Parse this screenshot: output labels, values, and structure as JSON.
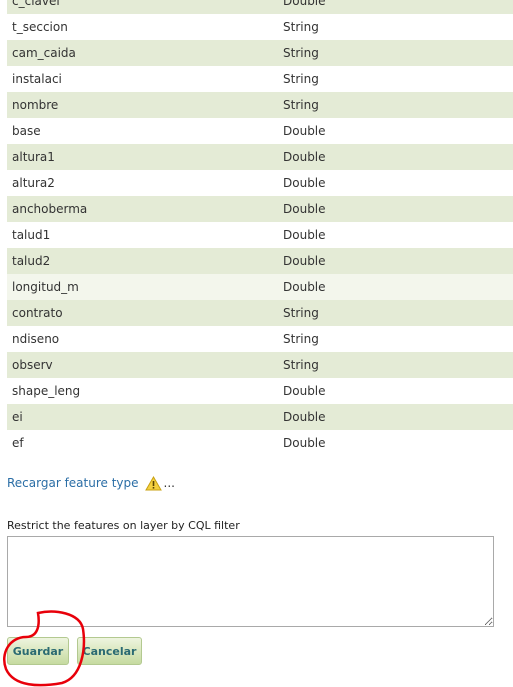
{
  "attributes": [
    {
      "name": "c_clavel",
      "type": "Double"
    },
    {
      "name": "t_seccion",
      "type": "String"
    },
    {
      "name": "cam_caida",
      "type": "String"
    },
    {
      "name": "instalaci",
      "type": "String"
    },
    {
      "name": "nombre",
      "type": "String"
    },
    {
      "name": "base",
      "type": "Double"
    },
    {
      "name": "altura1",
      "type": "Double"
    },
    {
      "name": "altura2",
      "type": "Double"
    },
    {
      "name": "anchoberma",
      "type": "Double"
    },
    {
      "name": "talud1",
      "type": "Double"
    },
    {
      "name": "talud2",
      "type": "Double"
    },
    {
      "name": "longitud_m",
      "type": "Double"
    },
    {
      "name": "contrato",
      "type": "String"
    },
    {
      "name": "ndiseno",
      "type": "String"
    },
    {
      "name": "observ",
      "type": "String"
    },
    {
      "name": "shape_leng",
      "type": "Double"
    },
    {
      "name": "ei",
      "type": "Double"
    },
    {
      "name": "ef",
      "type": "Double"
    }
  ],
  "reload": {
    "label": "Recargar feature type",
    "dots": "...",
    "icon": "warning-icon"
  },
  "cql": {
    "label": "Restrict the features on layer by CQL filter",
    "value": ""
  },
  "buttons": {
    "save": "Guardar",
    "cancel": "Cancelar"
  },
  "colors": {
    "row_alt": "#e4ebd6",
    "link": "#2b6ea6",
    "annotation": "#e8000a",
    "button_text": "#2a6a72"
  }
}
